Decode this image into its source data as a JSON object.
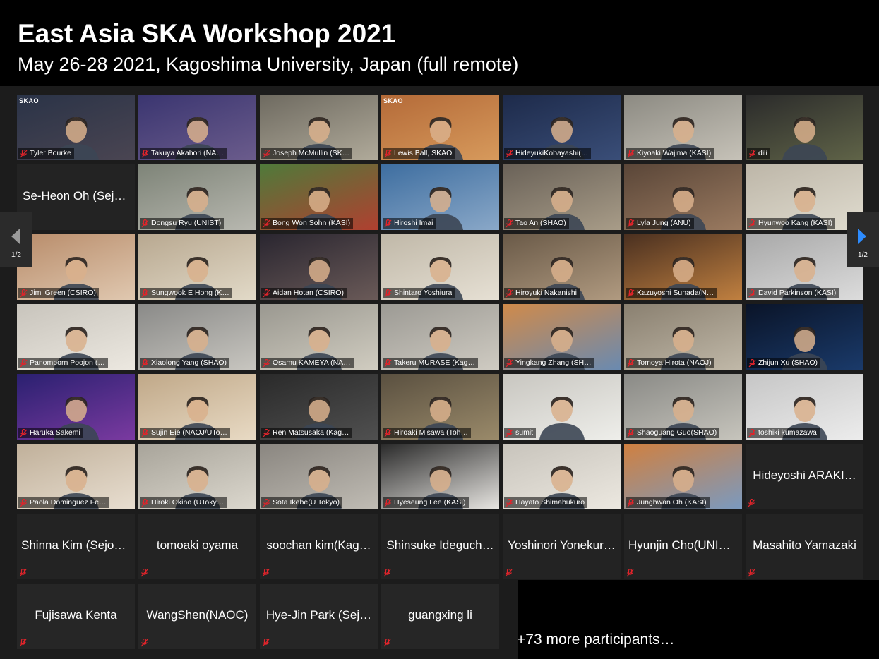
{
  "header": {
    "title": "East Asia SKA Workshop 2021",
    "subtitle": "May 26-28 2021, Kagoshima University, Japan (full remote)"
  },
  "pagination": {
    "left_label": "1/2",
    "right_label": "1/2"
  },
  "more_participants": "+73 more participants…",
  "colors": {
    "gallery_bg": "#1c1c1c",
    "tile_bg": "#232323",
    "active_speaker_border": "#c8cc80",
    "mute_icon": "#e0242b",
    "nav_arrow_right": "#2d8cff"
  },
  "tiles": [
    {
      "name": "Tyler Bourke",
      "video": true,
      "bg": [
        "#2a3347",
        "#4a4552"
      ],
      "logo": "SKAO"
    },
    {
      "name": "Takuya Akahori (NA…",
      "video": true,
      "bg": [
        "#3a3570",
        "#6b5c8c"
      ]
    },
    {
      "name": "Joseph McMullin (SK…",
      "video": true,
      "bg": [
        "#6e6a60",
        "#b0aa9a"
      ]
    },
    {
      "name": "Lewis Ball, SKAO",
      "video": true,
      "bg": [
        "#b46a38",
        "#d79a5c"
      ],
      "logo": "SKAO"
    },
    {
      "name": "HideyukiKobayashi(…",
      "video": true,
      "bg": [
        "#1d2a4a",
        "#3a4e78"
      ],
      "active": true
    },
    {
      "name": "Kiyoaki Wajima (KASI)",
      "video": true,
      "bg": [
        "#8c8a82",
        "#c6c2b8"
      ]
    },
    {
      "name": "dili",
      "video": true,
      "bg": [
        "#2a2a2a",
        "#606448"
      ]
    },
    {
      "name": "Se-Heon Oh (Sejo…",
      "video": false,
      "left": true
    },
    {
      "name": "Dongsu Ryu (UNIST)",
      "video": true,
      "bg": [
        "#7e8478",
        "#b8b8b0"
      ]
    },
    {
      "name": "Bong Won Sohn (KASI)",
      "video": true,
      "bg": [
        "#4f7a3a",
        "#b04030"
      ]
    },
    {
      "name": "Hiroshi Imai",
      "video": true,
      "bg": [
        "#3e6ea0",
        "#8aa8c8"
      ]
    },
    {
      "name": "Tao An (SHAO)",
      "video": true,
      "bg": [
        "#6a6258",
        "#a89c88"
      ]
    },
    {
      "name": "Lyla Jung (ANU)",
      "video": true,
      "bg": [
        "#5a4638",
        "#9a7a60"
      ]
    },
    {
      "name": "Hyunwoo Kang (KASI)",
      "video": true,
      "bg": [
        "#bdb6a8",
        "#e0dccf"
      ]
    },
    {
      "name": "Jimi Green (CSIRO)",
      "video": true,
      "bg": [
        "#b88c6a",
        "#e0c8b0"
      ]
    },
    {
      "name": "Sungwook E Hong (K…",
      "video": true,
      "bg": [
        "#b8a890",
        "#e2dac8"
      ]
    },
    {
      "name": "Aidan Hotan (CSIRO)",
      "video": true,
      "bg": [
        "#2a2630",
        "#6a5a58"
      ]
    },
    {
      "name": "Shintaro Yoshiura",
      "video": true,
      "bg": [
        "#c0b8a8",
        "#e6e0d4"
      ]
    },
    {
      "name": "Hiroyuki Nakanishi",
      "video": true,
      "bg": [
        "#6a5a48",
        "#b09a80"
      ]
    },
    {
      "name": "Kazuyoshi Sunada(N…",
      "video": true,
      "bg": [
        "#4a3020",
        "#c08040"
      ]
    },
    {
      "name": "David Parkinson (KASI)",
      "video": true,
      "bg": [
        "#a8a8a8",
        "#dcdcdc"
      ]
    },
    {
      "name": "Panomporn Poojon (…",
      "video": true,
      "bg": [
        "#c8c4bc",
        "#ece8e0"
      ]
    },
    {
      "name": "Xiaolong Yang (SHAO)",
      "video": true,
      "bg": [
        "#8a8a88",
        "#c8c6c0"
      ]
    },
    {
      "name": "Osamu KAMEYA (NA…",
      "video": true,
      "bg": [
        "#9a9890",
        "#d0ccc0"
      ]
    },
    {
      "name": "Takeru MURASE (Kag…",
      "video": true,
      "bg": [
        "#9c9a94",
        "#cfcbc2"
      ]
    },
    {
      "name": "Yingkang Zhang (SH…",
      "video": true,
      "bg": [
        "#d08a4a",
        "#6a8ab0"
      ]
    },
    {
      "name": "Tomoya Hirota (NAOJ)",
      "video": true,
      "bg": [
        "#8a8070",
        "#c0b8a8"
      ]
    },
    {
      "name": "Zhijun Xu (SHAO)",
      "video": true,
      "bg": [
        "#0a1428",
        "#1a3a6a"
      ]
    },
    {
      "name": "Haruka Sakemi",
      "video": true,
      "bg": [
        "#2a2070",
        "#7a3aa0"
      ]
    },
    {
      "name": "Sujin Eie (NAOJ/UTo…",
      "video": true,
      "bg": [
        "#c0a888",
        "#e8dac4"
      ]
    },
    {
      "name": "Ren Matsusaka (Kag…",
      "video": true,
      "bg": [
        "#2a2a2a",
        "#505050"
      ]
    },
    {
      "name": "Hiroaki Misawa (Toh…",
      "video": true,
      "bg": [
        "#5a5040",
        "#9a8a6a"
      ]
    },
    {
      "name": "sumit",
      "video": true,
      "bg": [
        "#c8c6c0",
        "#eeeeea"
      ]
    },
    {
      "name": "Shaoguang Guo(SHAO)",
      "video": true,
      "bg": [
        "#8a8a86",
        "#c6c4bc"
      ]
    },
    {
      "name": "toshiki kumazawa",
      "video": true,
      "bg": [
        "#c6c6c6",
        "#ececec"
      ]
    },
    {
      "name": "Paola Dominguez Fe…",
      "video": true,
      "bg": [
        "#c0b09a",
        "#e8ded0"
      ]
    },
    {
      "name": "Hiroki Okino (UToky…",
      "video": true,
      "bg": [
        "#a8a49a",
        "#dcd8ce"
      ]
    },
    {
      "name": "Sota Ikebe(U Tokyo)",
      "video": true,
      "bg": [
        "#8a8680",
        "#c0bcb4"
      ]
    },
    {
      "name": "Hyeseung Lee (KASI)",
      "video": true,
      "bg": [
        "#2a2a2a",
        "#e8e6e2"
      ]
    },
    {
      "name": "Hayato Shimabukuro",
      "video": true,
      "bg": [
        "#c8c4bc",
        "#ece8e0"
      ]
    },
    {
      "name": "Junghwan Oh (KASI)",
      "video": true,
      "bg": [
        "#d08040",
        "#7a9ac0"
      ]
    },
    {
      "name": "Hideyoshi ARAKI…",
      "video": false
    },
    {
      "name": "Shinna Kim (Sejon…",
      "video": false
    },
    {
      "name": "tomoaki oyama",
      "video": false
    },
    {
      "name": "soochan kim(Kag…",
      "video": false
    },
    {
      "name": "Shinsuke Ideguch…",
      "video": false
    },
    {
      "name": "Yoshinori Yonekur…",
      "video": false
    },
    {
      "name": "Hyunjin Cho(UNIS…",
      "video": false
    },
    {
      "name": "Masahito Yamazaki",
      "video": false
    },
    {
      "name": "Fujisawa Kenta",
      "video": false
    },
    {
      "name": "WangShen(NAOC)",
      "video": false
    },
    {
      "name": "Hye-Jin Park (Sej…",
      "video": false
    },
    {
      "name": "guangxing li",
      "video": false
    }
  ]
}
